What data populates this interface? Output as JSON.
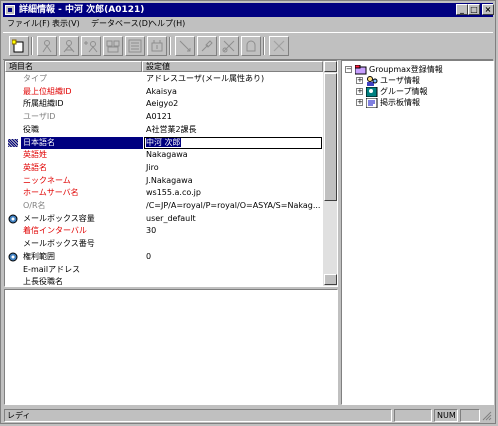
{
  "window": {
    "title": "詳細情報 - 中河 次郎(A0121)"
  },
  "menu": [
    "ファイル(F)",
    "表示(V)",
    "データベース(D)",
    "ヘルプ(H)"
  ],
  "toolbar": {
    "icons": [
      "new-icon",
      "tool-icon",
      "tool-icon",
      "tool-icon",
      "tool-icon",
      "tool-icon",
      "tool-icon",
      "tool-icon",
      "tool-icon",
      "tool-icon",
      "tool-icon",
      "delete-icon"
    ]
  },
  "list": {
    "headers": {
      "name": "項目名",
      "value": "設定値"
    },
    "rows": [
      {
        "label": "タイプ",
        "value": "アドレスユーザ(メール属性あり)"
      },
      {
        "label": "最上位組織ID",
        "value": "Akaisya"
      },
      {
        "label": "所属組織ID",
        "value": "Aeigyo2"
      },
      {
        "label": "ユーザID",
        "value": "A0121"
      },
      {
        "label": "役職",
        "value": "A社営業2課長"
      },
      {
        "label": "日本語名",
        "value": "中河 次郎"
      },
      {
        "label": "英語姓",
        "value": "Nakagawa"
      },
      {
        "label": "英語名",
        "value": "Jiro"
      },
      {
        "label": "ニックネーム",
        "value": "J.Nakagawa"
      },
      {
        "label": "ホームサーバ名",
        "value": "ws155.a.co.jp"
      },
      {
        "label": "O/R名",
        "value": "/C=JP/A=royal/P=royal/O=ASYA/S=Nakag..."
      },
      {
        "label": "メールボックス容量",
        "value": "user_default"
      },
      {
        "label": "着信インターバル",
        "value": "30"
      },
      {
        "label": "メールボックス番号",
        "value": ""
      },
      {
        "label": "権利範囲",
        "value": "0"
      },
      {
        "label": "E-mailアドレス",
        "value": ""
      },
      {
        "label": "上長役職名",
        "value": ""
      }
    ]
  },
  "tree": {
    "root": "Groupmax登録情報",
    "items": [
      "ユーザ情報",
      "グループ情報",
      "掲示板情報"
    ]
  },
  "status": {
    "text": "レディ",
    "num": "NUM"
  },
  "colors": {
    "titlebar": "#000080",
    "selection": "#000080",
    "required": "#e00000",
    "disabled": "#808080"
  }
}
